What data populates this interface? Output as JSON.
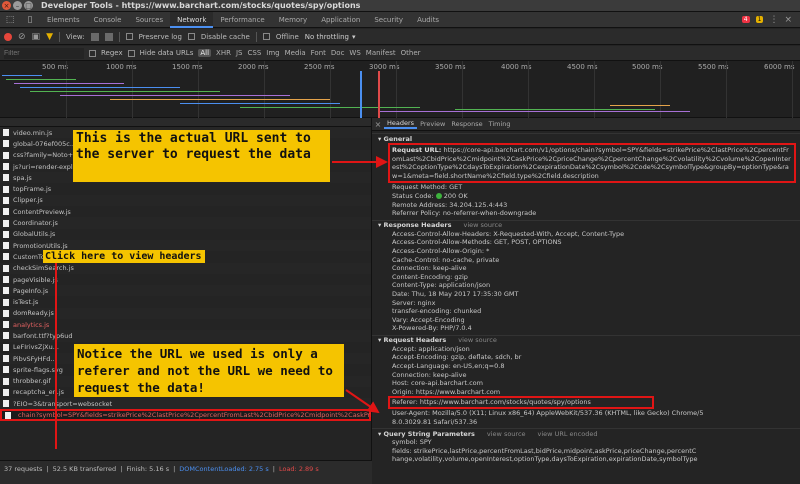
{
  "window": {
    "title": "Developer Tools - https://www.barchart.com/stocks/quotes/spy/options"
  },
  "tabs": [
    "Elements",
    "Console",
    "Sources",
    "Network",
    "Performance",
    "Memory",
    "Application",
    "Security",
    "Audits"
  ],
  "active_tab": "Network",
  "badges": {
    "errors": "4",
    "warnings": "1"
  },
  "toolbar": {
    "view_label": "View:",
    "preserve_log": "Preserve log",
    "disable_cache": "Disable cache",
    "offline": "Offline",
    "throttling": "No throttling"
  },
  "filterbar": {
    "placeholder": "Filter",
    "regex": "Regex",
    "hide_data_urls": "Hide data URLs",
    "types": [
      "All",
      "XHR",
      "JS",
      "CSS",
      "Img",
      "Media",
      "Font",
      "Doc",
      "WS",
      "Manifest",
      "Other"
    ]
  },
  "timeline_ticks": [
    "500 ms",
    "1000 ms",
    "1500 ms",
    "2000 ms",
    "2500 ms",
    "3000 ms",
    "3500 ms",
    "4000 ms",
    "4500 ms",
    "5000 ms",
    "5500 ms",
    "6000 ms"
  ],
  "requests": [
    {
      "name": "video.min.js"
    },
    {
      "name": "global-076ef005c..."
    },
    {
      "name": "css?family=Noto+S..."
    },
    {
      "name": "js?uri=render-expli..."
    },
    {
      "name": "spa.js"
    },
    {
      "name": "topFrame.js"
    },
    {
      "name": "Clipper.js"
    },
    {
      "name": "ContentPreview.js"
    },
    {
      "name": "Coordinator.js"
    },
    {
      "name": "GlobalUtils.js"
    },
    {
      "name": "PromotionUtils.js"
    },
    {
      "name": "CustomToolTipEligibility.js"
    },
    {
      "name": "checkSimSearch.js"
    },
    {
      "name": "pageVisible.js"
    },
    {
      "name": "PageInfo.js"
    },
    {
      "name": "isTest.js"
    },
    {
      "name": "domReady.js"
    },
    {
      "name": "analytics.js",
      "error": true
    },
    {
      "name": "barfont.ttf?typ6ud"
    },
    {
      "name": "LeFIrivsZjXu..."
    },
    {
      "name": "PibvSFyHFd..."
    },
    {
      "name": "sprite-flags.svg"
    },
    {
      "name": "throbber.gif"
    },
    {
      "name": "recaptcha_en.js"
    },
    {
      "name": "?EIO=3&transport=websocket"
    }
  ],
  "selected_request": "chain?symbol=SPY&fields=strikePrice%2ClastPrice%2CpercentFromLast%2CbidPrice%2Cmidpoint%2CaskPrice...",
  "statusbar": {
    "requests": "37 requests",
    "transferred": "52.5 KB transferred",
    "finish": "Finish: 5.16 s",
    "dcl": "DOMContentLoaded: 2.75 s",
    "load": "Load: 2.89 s"
  },
  "detail_tabs": [
    "Headers",
    "Preview",
    "Response",
    "Timing"
  ],
  "general": {
    "title": "General",
    "request_url_key": "Request URL:",
    "request_url_value": "https://core-api.barchart.com/v1/options/chain?symbol=SPY&fields=strikePrice%2ClastPrice%2CpercentFromLast%2CbidPrice%2Cmidpoint%2CaskPrice%2CpriceChange%2CpercentChange%2Cvolatility%2Cvolume%2CopenInterest%2CoptionType%2CdaysToExpiration%2CexpirationDate%2Csymbol%2Code%2CsymbolType&groupBy=optionType&raw=1&meta=field.shortName%2Cfield.type%2Cfield.description",
    "method": "Request Method: GET",
    "status_key": "Status Code:",
    "status_value": "200 OK",
    "remote": "Remote Address: 34.204.125.4:443",
    "policy": "Referrer Policy: no-referrer-when-downgrade"
  },
  "response_headers": {
    "title": "Response Headers",
    "view_source": "view source",
    "items": [
      "Access-Control-Allow-Headers: X-Requested-With, Accept, Content-Type",
      "Access-Control-Allow-Methods: GET, POST, OPTIONS",
      "Access-Control-Allow-Origin: *",
      "Cache-Control: no-cache, private",
      "Connection: keep-alive",
      "Content-Encoding: gzip",
      "Content-Type: application/json",
      "Date: Thu, 18 May 2017 17:35:30 GMT",
      "Server: nginx",
      "transfer-encoding: chunked",
      "Vary: Accept-Encoding",
      "X-Powered-By: PHP/7.0.4"
    ]
  },
  "request_headers": {
    "title": "Request Headers",
    "view_source": "view source",
    "items": [
      "Accept: application/json",
      "Accept-Encoding: gzip, deflate, sdch, br",
      "Accept-Language: en-US,en;q=0.8",
      "Connection: keep-alive",
      "Host: core-api.barchart.com",
      "Origin: https://www.barchart.com"
    ],
    "referer": "Referer: https://www.barchart.com/stocks/quotes/spy/options",
    "user_agent_1": "User-Agent: Mozilla/5.0 (X11; Linux x86_64) AppleWebKit/537.36 (KHTML, like Gecko) Chrome/5",
    "user_agent_2": "8.0.3029.81 Safari/537.36"
  },
  "query_string": {
    "title": "Query String Parameters",
    "view_source": "view source",
    "view_url_encoded": "view URL encoded",
    "symbol": "symbol: SPY",
    "fields": "fields: strikePrice,lastPrice,percentFromLast,bidPrice,midpoint,askPrice,priceChange,percentC",
    "fields_2": "hange,volatility,volume,openInterest,optionType,daysToExpiration,expirationDate,symbolType"
  },
  "annotations": {
    "note1": "This is the actual URL sent to the server to request the data",
    "note2": "Click here to view headers",
    "note3": "Notice the URL we used is only a referer and not the URL we need to request the data!"
  },
  "colors": {
    "annotation_bg": "#f5c400",
    "highlight_border": "#e01515",
    "accent": "#4b8ff0"
  }
}
